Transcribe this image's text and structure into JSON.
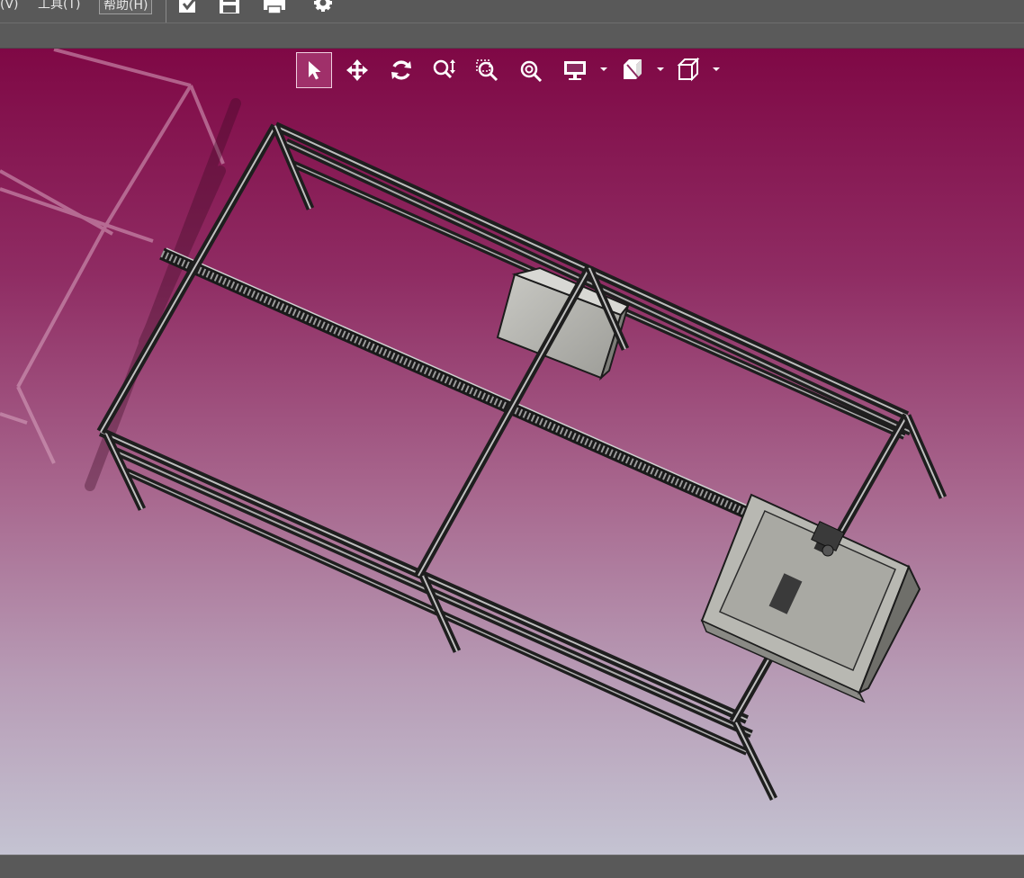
{
  "menu": {
    "view": "(V)",
    "tools": "工具(T)",
    "help": "帮助(H)"
  },
  "toolbar": {
    "icons": [
      "import-icon",
      "save-icon",
      "print-icon",
      "settings-icon"
    ]
  },
  "view_toolbar": {
    "buttons": [
      "select",
      "pan",
      "rotate",
      "zoom-dynamic",
      "zoom-window",
      "zoom-fit",
      "display-mode",
      "section-view",
      "view-orientation"
    ],
    "active": "select"
  },
  "colors": {
    "chrome": "#595959",
    "viewport_top": "#7f0845",
    "viewport_bottom": "#c4c3d2",
    "frame_profile": "#2b2b2b",
    "frame_highlight": "#c8c8c8",
    "box_face": "#b4b4ae",
    "active_button": "#a0306a"
  }
}
